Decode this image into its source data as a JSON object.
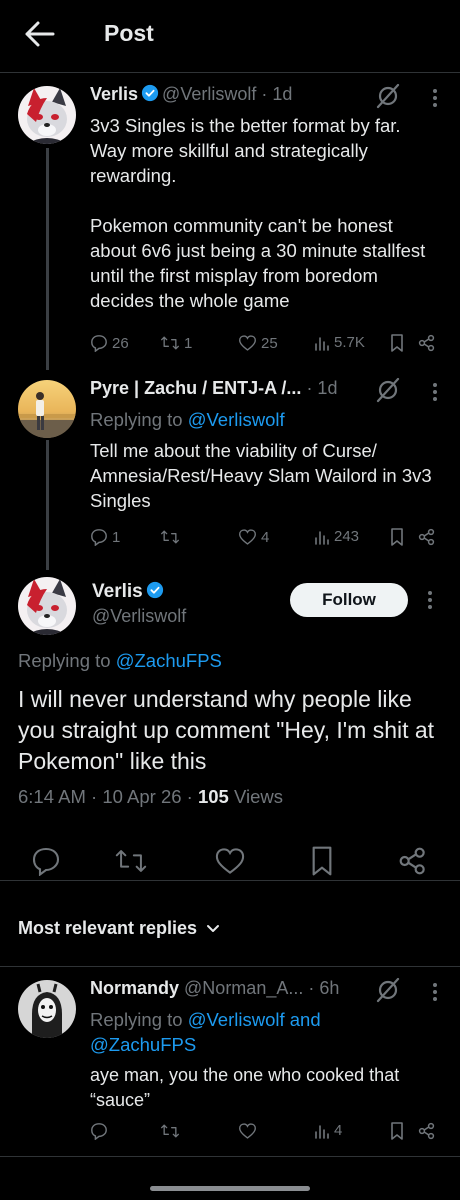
{
  "header": {
    "title": "Post",
    "back_icon": "arrow-left-icon"
  },
  "colors": {
    "background": "#000000",
    "text": "#e7e9ea",
    "muted": "#71767b",
    "link": "#1d9bf0",
    "verified": "#1d9bf0"
  },
  "thread": [
    {
      "name": "Verlis",
      "handle": "@Verliswolf",
      "time": "· 1d",
      "verified": true,
      "paragraph1": "3v3 Singles is the better format by far. Way more skillful and strategically rewarding.",
      "paragraph2": "Pokemon community can't be honest about 6v6 just being a 30 minute stallfest until the first misplay from boredom decides the whole game",
      "replies": "26",
      "reposts": "1",
      "likes": "25",
      "views": "5.7K"
    },
    {
      "name": "Pyre | Zachu / ENTJ-A /...",
      "time": "· 1d",
      "reply_prefix": "Replying to ",
      "reply_to": "@Verliswolf",
      "text": "Tell me about the viability of Curse/ Amnesia/Rest/Heavy Slam Wailord in 3v3 Singles",
      "replies": "1",
      "reposts": "",
      "likes": "4",
      "views": "243"
    }
  ],
  "focus": {
    "name": "Verlis",
    "handle": "@Verliswolf",
    "follow_label": "Follow",
    "reply_prefix": "Replying to ",
    "reply_to": "@ZachuFPS",
    "text": "I will never understand why people like you straight up comment \"Hey, I'm shit at Pokemon\" like this",
    "time": "6:14 AM",
    "date": "· 10 Apr 26 ·",
    "views_count": "105",
    "views_label": "Views"
  },
  "replies_header": "Most relevant replies",
  "reply": {
    "name": "Normandy",
    "handle": "@Norman_A...",
    "time": "· 6h",
    "reply_prefix": "Replying to ",
    "reply_to_1": "@Verliswolf and",
    "reply_to_2": "@ZachuFPS",
    "text": "aye man, you the one who cooked that “sauce”",
    "replies": "",
    "reposts": "",
    "likes": "",
    "views": "4"
  }
}
